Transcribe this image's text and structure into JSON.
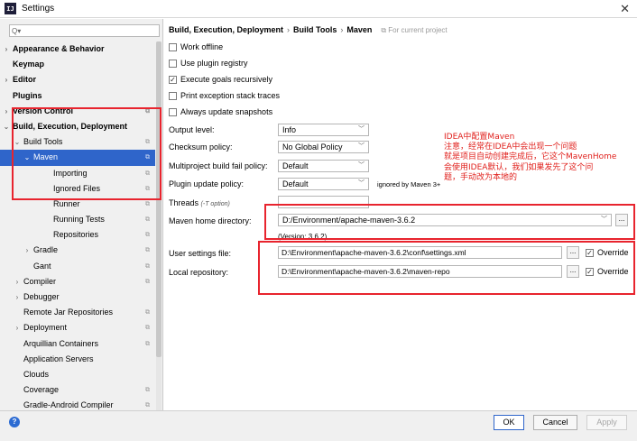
{
  "window": {
    "title": "Settings",
    "app_icon": "IJ"
  },
  "sidebar": {
    "search_placeholder": "",
    "items": [
      {
        "label": "Appearance & Behavior",
        "arrow": ">",
        "bold": true,
        "indent": 0
      },
      {
        "label": "Keymap",
        "arrow": "",
        "bold": true,
        "indent": 0
      },
      {
        "label": "Editor",
        "arrow": ">",
        "bold": true,
        "indent": 0
      },
      {
        "label": "Plugins",
        "arrow": "",
        "bold": true,
        "indent": 0
      },
      {
        "label": "Version Control",
        "arrow": ">",
        "bold": true,
        "indent": 0,
        "cfg": true
      },
      {
        "label": "Build, Execution, Deployment",
        "arrow": "v",
        "bold": true,
        "indent": 0
      },
      {
        "label": "Build Tools",
        "arrow": "v",
        "bold": false,
        "indent": 1,
        "cfg": true
      },
      {
        "label": "Maven",
        "arrow": "v",
        "bold": false,
        "indent": 2,
        "cfg": true,
        "selected": true
      },
      {
        "label": "Importing",
        "arrow": "",
        "bold": false,
        "indent": 3,
        "cfg": true
      },
      {
        "label": "Ignored Files",
        "arrow": "",
        "bold": false,
        "indent": 3,
        "cfg": true
      },
      {
        "label": "Runner",
        "arrow": "",
        "bold": false,
        "indent": 3,
        "cfg": true
      },
      {
        "label": "Running Tests",
        "arrow": "",
        "bold": false,
        "indent": 3,
        "cfg": true
      },
      {
        "label": "Repositories",
        "arrow": "",
        "bold": false,
        "indent": 3,
        "cfg": true
      },
      {
        "label": "Gradle",
        "arrow": ">",
        "bold": false,
        "indent": 2,
        "cfg": true
      },
      {
        "label": "Gant",
        "arrow": "",
        "bold": false,
        "indent": 2,
        "cfg": true
      },
      {
        "label": "Compiler",
        "arrow": ">",
        "bold": false,
        "indent": 1,
        "cfg": true
      },
      {
        "label": "Debugger",
        "arrow": ">",
        "bold": false,
        "indent": 1
      },
      {
        "label": "Remote Jar Repositories",
        "arrow": "",
        "bold": false,
        "indent": 1,
        "cfg": true
      },
      {
        "label": "Deployment",
        "arrow": ">",
        "bold": false,
        "indent": 1,
        "cfg": true
      },
      {
        "label": "Arquillian Containers",
        "arrow": "",
        "bold": false,
        "indent": 1,
        "cfg": true
      },
      {
        "label": "Application Servers",
        "arrow": "",
        "bold": false,
        "indent": 1
      },
      {
        "label": "Clouds",
        "arrow": "",
        "bold": false,
        "indent": 1
      },
      {
        "label": "Coverage",
        "arrow": "",
        "bold": false,
        "indent": 1,
        "cfg": true
      },
      {
        "label": "Gradle-Android Compiler",
        "arrow": "",
        "bold": false,
        "indent": 1,
        "cfg": true
      }
    ]
  },
  "breadcrumb": {
    "part1": "Build, Execution, Deployment",
    "sep1": "›",
    "part2": "Build Tools",
    "sep2": "›",
    "part3": "Maven",
    "project_note": "⧉ For current project"
  },
  "checkboxes": [
    {
      "label": "Work offline",
      "checked": false
    },
    {
      "label": "Use plugin registry",
      "checked": false
    },
    {
      "label": "Execute goals recursively",
      "checked": true
    },
    {
      "label": "Print exception stack traces",
      "checked": false
    },
    {
      "label": "Always update snapshots",
      "checked": false
    }
  ],
  "form": {
    "output_level": {
      "label": "Output level:",
      "value": "Info"
    },
    "checksum_policy": {
      "label": "Checksum policy:",
      "value": "No Global Policy"
    },
    "multiproject_fail": {
      "label": "Multiproject build fail policy:",
      "value": "Default"
    },
    "plugin_update": {
      "label": "Plugin update policy:",
      "value": "Default",
      "note": "ignored by Maven 3+"
    },
    "threads": {
      "label": "Threads",
      "hint": "(-T option)",
      "value": ""
    },
    "maven_home": {
      "label": "Maven home directory:",
      "value": "D:/Environment/apache-maven-3.6.2",
      "version": "(Version: 3.6.2)"
    },
    "user_settings": {
      "label": "User settings file:",
      "value": "D:\\Environment\\apache-maven-3.6.2\\conf\\settings.xml",
      "override": "Override",
      "override_checked": true
    },
    "local_repo": {
      "label": "Local repository:",
      "value": "D:\\Environment\\apache-maven-3.6.2\\maven-repo",
      "override": "Override",
      "override_checked": true
    }
  },
  "annotation": {
    "line1": "IDEA中配置Maven",
    "line2": "注意，经常在IDEA中会出现一个问题",
    "line3": "就是项目自动创建完成后，它这个MavenHome",
    "line4": "会使用IDEA默认，我们如果发先了这个问",
    "line5": "题，手动改为本地的"
  },
  "footer": {
    "ok": "OK",
    "cancel": "Cancel",
    "apply": "Apply",
    "help": "?"
  },
  "colors": {
    "selection": "#2f65ca",
    "annotation_red": "#e0201c",
    "box_red": "#e8242e"
  }
}
